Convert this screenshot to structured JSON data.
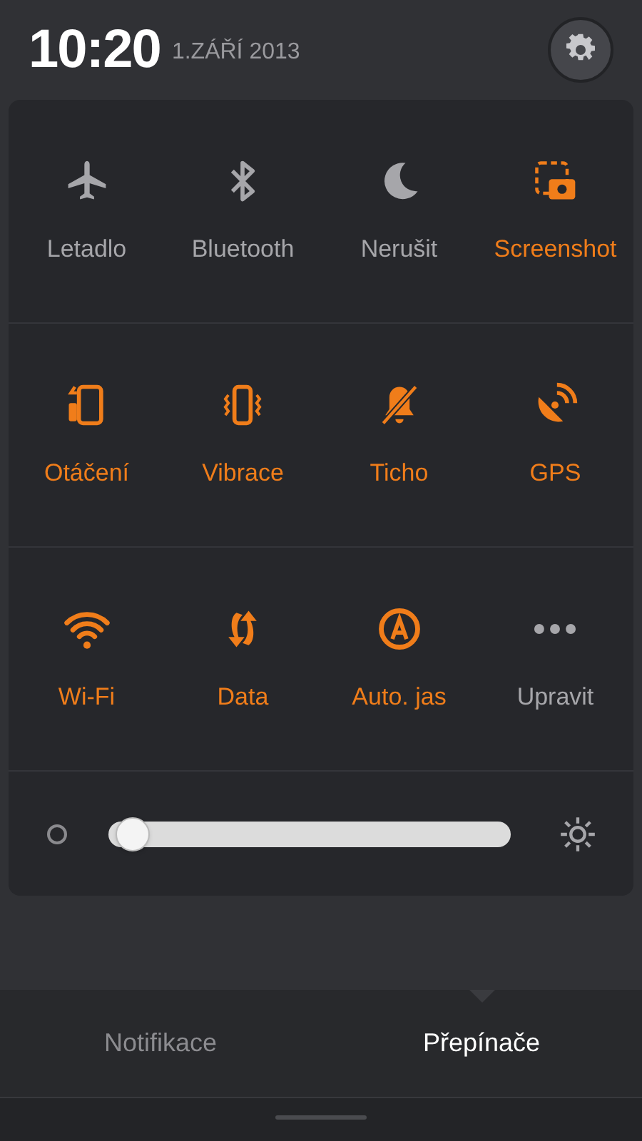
{
  "status": {
    "time": "10:20",
    "date": "1.ZÁŘÍ 2013"
  },
  "toggles": [
    {
      "label": "Letadlo",
      "on": false
    },
    {
      "label": "Bluetooth",
      "on": false
    },
    {
      "label": "Nerušit",
      "on": false
    },
    {
      "label": "Screenshot",
      "on": true
    },
    {
      "label": "Otáčení",
      "on": true
    },
    {
      "label": "Vibrace",
      "on": true
    },
    {
      "label": "Ticho",
      "on": true
    },
    {
      "label": "GPS",
      "on": true
    },
    {
      "label": "Wi-Fi",
      "on": true
    },
    {
      "label": "Data",
      "on": true
    },
    {
      "label": "Auto. jas",
      "on": true
    },
    {
      "label": "Upravit",
      "on": false
    }
  ],
  "brightness": {
    "level": 0.02
  },
  "tabs": [
    {
      "label": "Notifikace",
      "selected": false
    },
    {
      "label": "Přepínače",
      "selected": true
    }
  ]
}
